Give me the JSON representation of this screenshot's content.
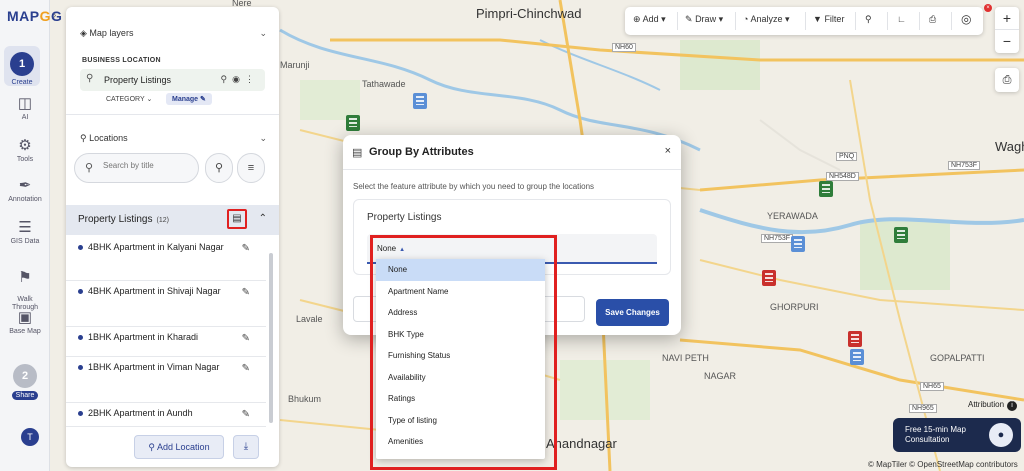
{
  "app": {
    "logo_main": "MAP",
    "logo_accent": "G",
    "logo_end": "G"
  },
  "rail": {
    "items": [
      {
        "label": "Create",
        "step": "1",
        "icon": "create"
      },
      {
        "label": "AI",
        "icon": "ai-icon"
      },
      {
        "label": "Tools",
        "icon": "tools-icon"
      },
      {
        "label": "Annotation",
        "icon": "annotation-icon"
      },
      {
        "label": "GIS Data",
        "icon": "layers-icon"
      },
      {
        "label": "Walk\nThrough",
        "icon": "walk-icon"
      },
      {
        "label": "Base Map",
        "icon": "basemap-icon"
      }
    ],
    "share_step": "2",
    "share_label": "Share",
    "avatar": "T"
  },
  "panel": {
    "map_layers": "Map layers",
    "business_location": "BUSINESS LOCATION",
    "layer_name": "Property Listings",
    "category": "CATEGORY",
    "manage": "Manage",
    "locations": "Locations",
    "search_placeholder": "Search by title",
    "list_title": "Property Listings",
    "list_count": "(12)",
    "items": [
      {
        "title": "4BHK Apartment in Kalyani Nagar"
      },
      {
        "title": "4BHK Apartment in Shivaji Nagar"
      },
      {
        "title": "1BHK Apartment in Kharadi"
      },
      {
        "title": "1BHK Apartment in Viman Nagar"
      },
      {
        "title": "2BHK Apartment in Aundh"
      }
    ],
    "add_location": "Add Location"
  },
  "toolbar": {
    "add": "Add",
    "draw": "Draw",
    "analyze": "Analyze",
    "filter": "Filter"
  },
  "modal": {
    "title": "Group By Attributes",
    "description": "Select the feature attribute by which you need to group the locations",
    "card_label": "Property Listings",
    "selected_value": "None",
    "save": "Save Changes",
    "options": [
      "None",
      "Apartment Name",
      "Address",
      "BHK Type",
      "Furnishing Status",
      "Availability",
      "Ratings",
      "Type of listing",
      "Amenities"
    ]
  },
  "map": {
    "labels": {
      "pimpri": "Pimpri-Chinchwad",
      "tathawade": "Tathawade",
      "marunji": "Marunji",
      "wagho": "Wagho",
      "yerawada": "YERAWADA",
      "ghorpuri": "GHORPURI",
      "navi_peth": "NAVI PETH",
      "nagar": "NAGAR",
      "gopalpatti": "GOPALPATTI",
      "lavale": "Lavale",
      "bhukum": "Bhukum",
      "anandnagar": "Anandnagar",
      "nere": "Nere"
    },
    "roads": {
      "nh60": "NH60",
      "nh753f": "NH753F",
      "nh65": "NH65",
      "nh965": "NH965",
      "nh548d": "NH548D",
      "pno": "PNQ"
    }
  },
  "bottom": {
    "attribution": "Attribution",
    "consult_line1": "Free 15-min Map",
    "consult_line2": "Consultation",
    "copyright": "© MapTiler © OpenStreetMap contributors"
  }
}
